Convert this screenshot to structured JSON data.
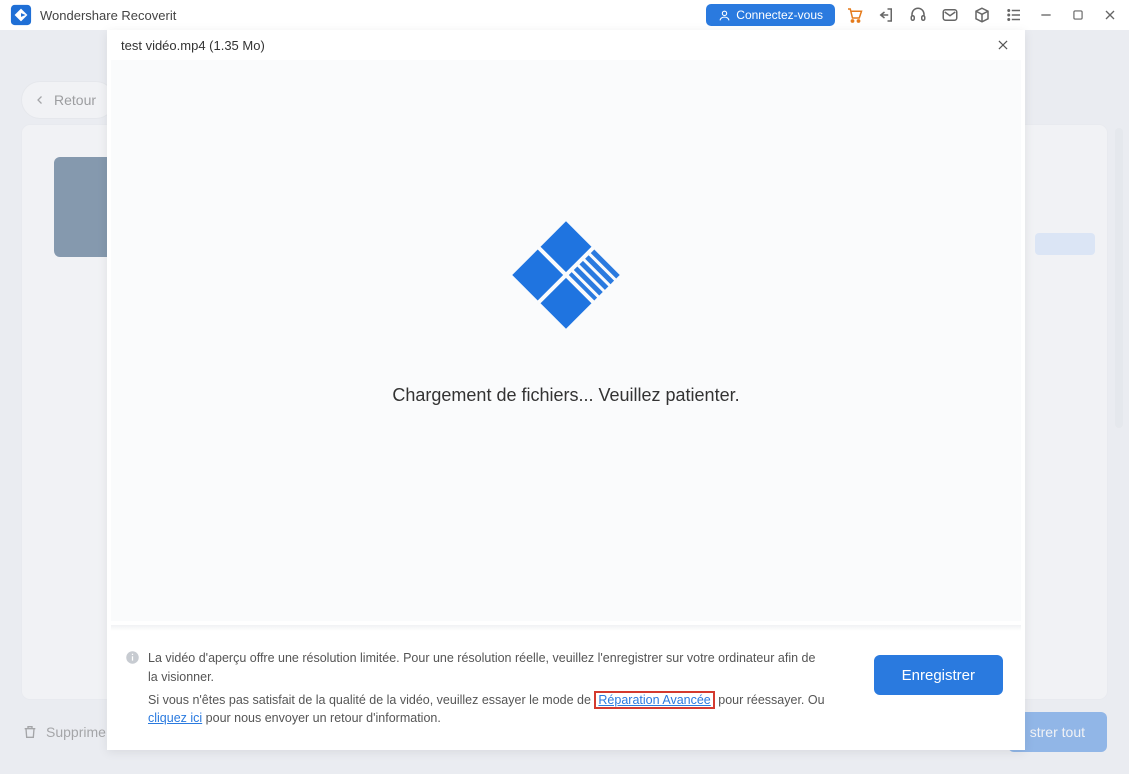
{
  "app": {
    "title": "Wondershare Recoverit"
  },
  "titlebar": {
    "connect_label": "Connectez-vous"
  },
  "back": {
    "label": "Retour"
  },
  "bottom": {
    "delete_label": "Supprime",
    "save_all_label": "strer tout"
  },
  "modal": {
    "filename": "test vidéo.mp4 (1.35 Mo)",
    "loading_text": "Chargement de fichiers... Veuillez patienter.",
    "info_line1": "La vidéo d'aperçu offre une résolution limitée. Pour une résolution réelle, veuillez l'enregistrer sur votre ordinateur afin de la visionner.",
    "info_line2_a": "Si vous n'êtes pas satisfait de la qualité de la vidéo, veuillez essayer le mode de ",
    "info_link_repair": "Réparation Avancée",
    "info_line2_b": " pour réessayer. Ou ",
    "info_link_click": "cliquez ici",
    "info_line2_c": " pour nous envoyer un retour d'information.",
    "save_label": "Enregistrer"
  }
}
